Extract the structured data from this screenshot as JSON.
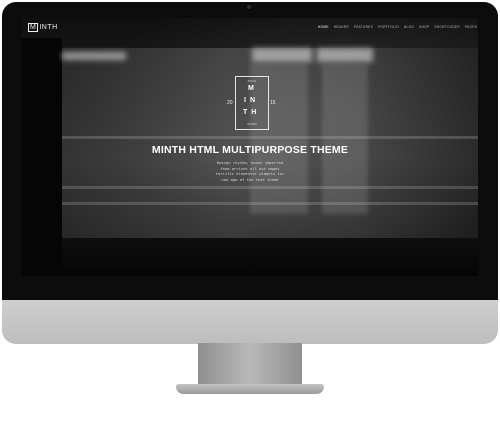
{
  "site": {
    "logo_text": "INTH",
    "logo_letter": "M"
  },
  "nav": {
    "items": [
      {
        "label": "HOME",
        "active": true
      },
      {
        "label": "HEADER"
      },
      {
        "label": "FEATURES"
      },
      {
        "label": "PORTFOLIO"
      },
      {
        "label": "BLOG"
      },
      {
        "label": "SHOP"
      },
      {
        "label": "SHORTCODES"
      },
      {
        "label": "PAGES"
      }
    ]
  },
  "emblem": {
    "top": "SINCE",
    "line1": "M",
    "line2": "IN",
    "line3": "TH",
    "year_left": "20",
    "year_right": "15",
    "bottom": "STUDIO"
  },
  "hero": {
    "title": "MINTH HTML MULTIPURPOSE THEME",
    "subtitle_lines": [
      "Design rhythm, bonus imported",
      "them arrives all out mages",
      "terrific elementor widgets for",
      "new age of the that theme"
    ]
  },
  "colors": {
    "screen_bg": "#101010",
    "text": "#ffffff",
    "chin": "#c9c9c9"
  }
}
